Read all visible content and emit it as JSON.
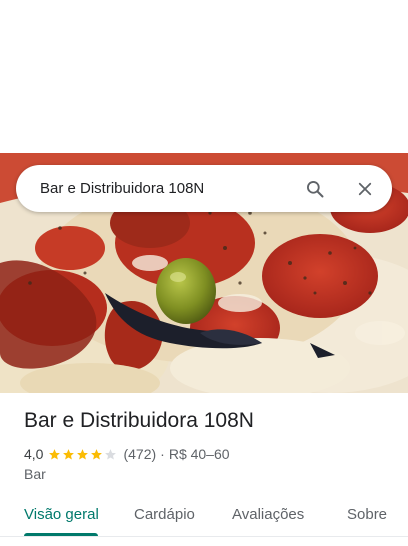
{
  "search": {
    "query": "Bar e Distribuidora 108N",
    "search_icon": "search-icon",
    "close_icon": "close-icon"
  },
  "hero_photo": {
    "description_icon": "pizza-photo"
  },
  "place": {
    "name": "Bar e Distribuidora 108N",
    "rating": "4,0",
    "rating_value": 4.0,
    "rating_max": 5,
    "reviews": "(472)",
    "separator": "·",
    "price": "R$ 40–60",
    "category": "Bar"
  },
  "tabs": [
    {
      "label": "Visão geral",
      "active": true
    },
    {
      "label": "Cardápio",
      "active": false
    },
    {
      "label": "Avaliações",
      "active": false
    },
    {
      "label": "Sobre",
      "active": false
    }
  ],
  "colors": {
    "accent": "#00796b",
    "star": "#fbbc04",
    "star_empty": "#dadce0"
  }
}
